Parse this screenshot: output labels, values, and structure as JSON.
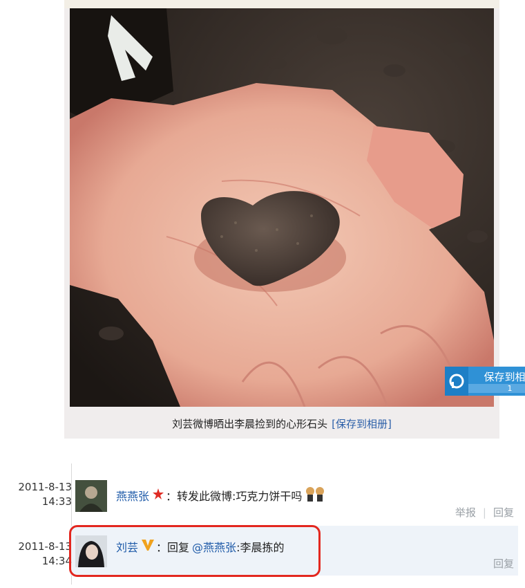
{
  "photo": {
    "save_badge_label": "保存到相册",
    "save_badge_count": "1",
    "caption_text": "刘芸微博晒出李晨捡到的心形石头",
    "caption_link": "[保存到相册]"
  },
  "comments": [
    {
      "date": "2011-8-13",
      "time": "14:33",
      "user": "燕燕张",
      "user_badge": "star-badge-icon",
      "separator": "：",
      "text": "转发此微博:巧克力饼干吗",
      "emoji": "twins-emoji-icon",
      "actions": [
        "举报",
        "回复"
      ]
    },
    {
      "date": "2011-8-13",
      "time": "14:34",
      "user": "刘芸",
      "user_badge": "verified-v-icon",
      "separator": "：",
      "reply_prefix": "回复",
      "mention": "@燕燕张",
      "text": ":李晨拣的",
      "actions": [
        "回复"
      ]
    }
  ],
  "colors": {
    "link": "#1e5aa8",
    "highlight_border": "#e3271f",
    "badge_blue": "#2f91d6"
  }
}
